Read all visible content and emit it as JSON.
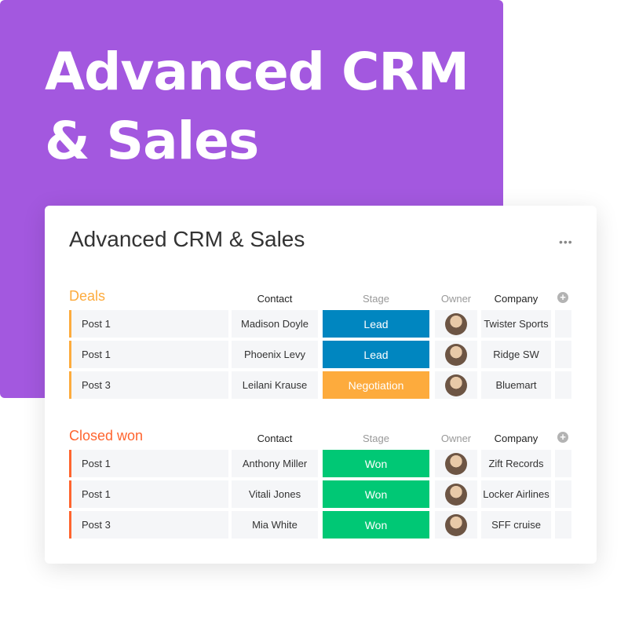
{
  "hero": {
    "title": "Advanced CRM & Sales",
    "color": "#a358df"
  },
  "board": {
    "title": "Advanced CRM & Sales",
    "more_label": "•••",
    "add_label": "+",
    "groups": [
      {
        "title": "Deals",
        "color": "#fdab3d",
        "headers": {
          "contact": "Contact",
          "stage": "Stage",
          "owner": "Owner",
          "company": "Company"
        },
        "rows": [
          {
            "name": "Post 1",
            "contact": "Madison Doyle",
            "stage": "Lead",
            "stage_color": "#0086c0",
            "company": "Twister Sports"
          },
          {
            "name": "Post 1",
            "contact": "Phoenix Levy",
            "stage": "Lead",
            "stage_color": "#0086c0",
            "company": "Ridge SW"
          },
          {
            "name": "Post 3",
            "contact": "Leilani Krause",
            "stage": "Negotiation",
            "stage_color": "#fdab3d",
            "company": "Bluemart"
          }
        ]
      },
      {
        "title": "Closed won",
        "color": "#ff642e",
        "headers": {
          "contact": "Contact",
          "stage": "Stage",
          "owner": "Owner",
          "company": "Company"
        },
        "rows": [
          {
            "name": "Post 1",
            "contact": "Anthony Miller",
            "stage": "Won",
            "stage_color": "#00c875",
            "company": "Zift Records"
          },
          {
            "name": "Post 1",
            "contact": "Vitali Jones",
            "stage": "Won",
            "stage_color": "#00c875",
            "company": "Locker Airlines"
          },
          {
            "name": "Post 3",
            "contact": "Mia White",
            "stage": "Won",
            "stage_color": "#00c875",
            "company": "SFF cruise"
          }
        ]
      }
    ]
  }
}
